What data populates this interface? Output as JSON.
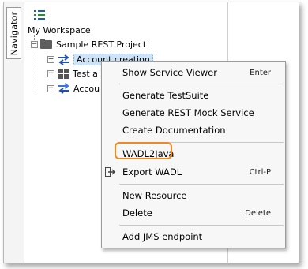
{
  "navigator_tab": "Navigator",
  "tree": {
    "workspace": "My Workspace",
    "project": "Sample REST Project",
    "items": [
      {
        "label": "Account creation",
        "selected": true,
        "icon": "arrows-icon"
      },
      {
        "label": "Test a",
        "icon": "grid-icon"
      },
      {
        "label": "Accou",
        "icon": "arrows-icon"
      }
    ]
  },
  "context_menu": {
    "items": [
      {
        "label": "Show Service Viewer",
        "shortcut": "Enter"
      },
      {
        "label": "Generate TestSuite",
        "shortcut": ""
      },
      {
        "label": "Generate REST Mock Service",
        "shortcut": ""
      },
      {
        "label": "Create Documentation",
        "shortcut": ""
      },
      {
        "label": "WADL2Java",
        "shortcut": "",
        "highlighted": true
      },
      {
        "label": "Export WADL",
        "shortcut": "Ctrl-P",
        "icon": "export-icon"
      },
      {
        "label": "New Resource",
        "shortcut": ""
      },
      {
        "label": "Delete",
        "shortcut": "Delete"
      },
      {
        "label": "Add JMS endpoint",
        "shortcut": ""
      }
    ]
  },
  "colors": {
    "highlight_border": "#f08a1c",
    "selection": "#cde3f8",
    "arrow_blue": "#1f4fa8"
  }
}
